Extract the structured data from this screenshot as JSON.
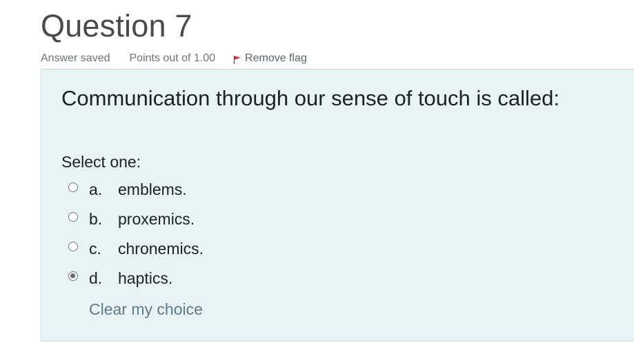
{
  "question": {
    "title": "Question 7",
    "status": "Answer saved",
    "points": "Points out of 1.00",
    "flag_label": "Remove flag",
    "text": "Communication through our sense of touch is called:",
    "prompt": "Select one:",
    "answers": [
      {
        "letter": "a.",
        "text": "emblems.",
        "selected": false
      },
      {
        "letter": "b.",
        "text": "proxemics.",
        "selected": false
      },
      {
        "letter": "c.",
        "text": "chronemics.",
        "selected": false
      },
      {
        "letter": "d.",
        "text": "haptics.",
        "selected": true
      }
    ],
    "clear_label": "Clear my choice"
  },
  "icons": {
    "flag": "flag-icon"
  },
  "colors": {
    "panel_background": "#e7f3f5",
    "panel_border": "#c3dfe4",
    "flag": "#e12a2a",
    "clear_link": "#5f7a88"
  }
}
